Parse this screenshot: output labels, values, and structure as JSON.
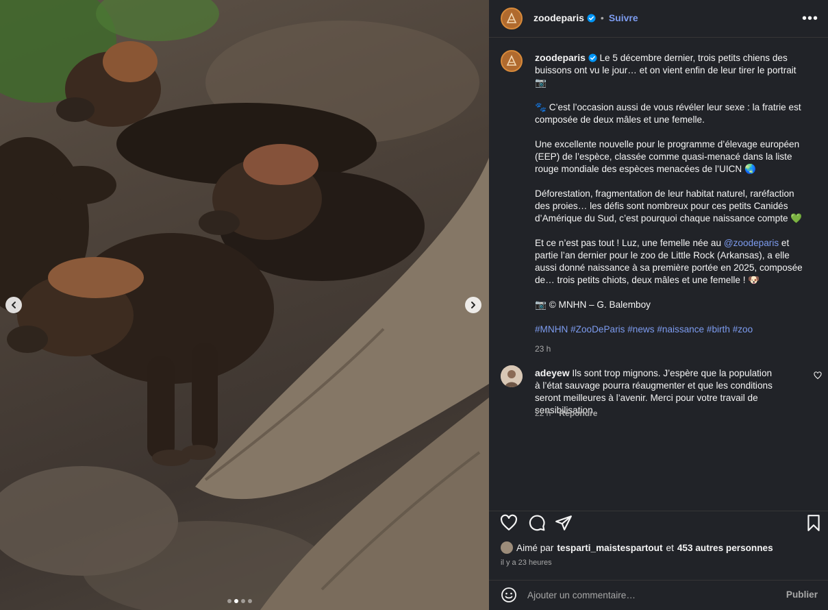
{
  "post": {
    "author": "zoodeparis",
    "follow_label": "Suivre",
    "separator": "•",
    "more_label": "•••",
    "caption": {
      "p1_text": "Le 5 décembre dernier, trois petits chiens des buissons ont vu le jour… et on vient enfin de leur tirer le portrait 📷",
      "p2": "🐾 C’est l’occasion aussi de vous révéler leur sexe : la fratrie est composée de deux mâles et une femelle.",
      "p3": "Une excellente nouvelle pour le programme d’élevage européen (EEP) de l’espèce, classée comme quasi-menacé dans la liste rouge mondiale des espèces menacées de l’UICN 🌏",
      "p4": "Déforestation, fragmentation de leur habitat naturel, raréfaction des proies… les défis sont nombreux pour ces petits Canidés d’Amérique du Sud, c’est pourquoi chaque naissance compte 💚",
      "p5_before": "Et ce n’est pas tout ! Luz, une femelle née au ",
      "p5_mention": "@zoodeparis",
      "p5_after": " et partie l’an dernier pour le zoo de Little Rock (Arkansas), a elle aussi donné naissance à sa première portée en 2025, composée de… trois petits chiots, deux mâles et une femelle ! 🐶",
      "p6": "📷 © MNHN – G. Balemboy",
      "hashtags": [
        "#MNHN",
        "#ZooDeParis",
        "#news",
        "#naissance",
        "#birth",
        "#zoo"
      ],
      "time": "23 h"
    },
    "comment": {
      "user": "adeyew",
      "text": "Ils sont trop mignons. J’espère que la population à l’état sauvage pourra réaugmenter et que les conditions seront meilleures à l’avenir. Merci pour votre travail de sensibilisation",
      "time": "22 h",
      "reply_label": "Répondre"
    },
    "likes": {
      "prefix": "Aimé par",
      "user": "tesparti_maistespartout",
      "connector": "et",
      "others": "453 autres personnes"
    },
    "posted_time": "il y a 23 heures",
    "add_comment": {
      "placeholder": "Ajouter un commentaire…",
      "publish_label": "Publier"
    },
    "carousel": {
      "slides": 4,
      "active_index": 1
    }
  }
}
